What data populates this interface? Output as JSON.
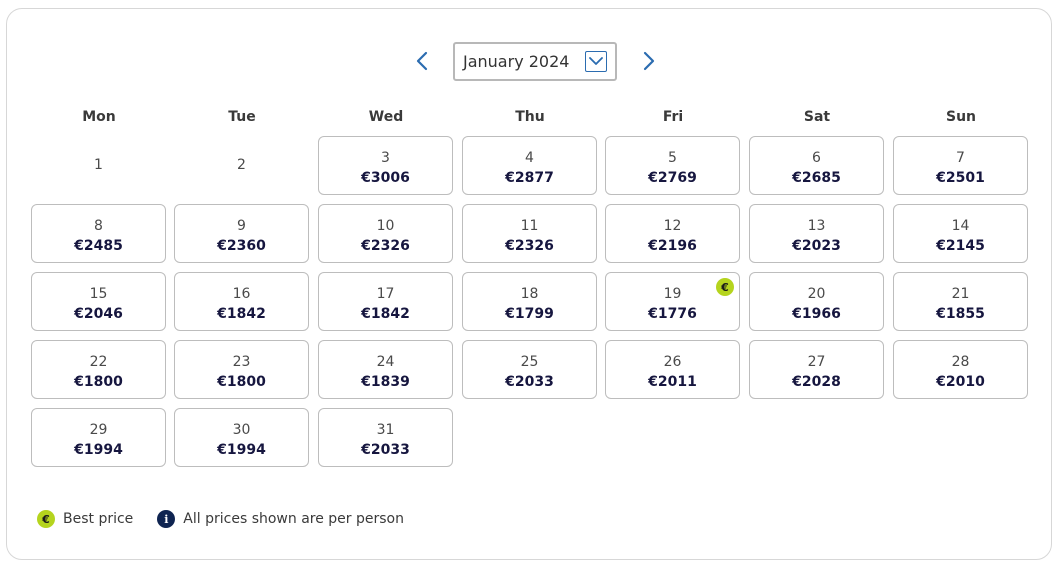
{
  "calendar": {
    "month_label": "January 2024",
    "weekdays": [
      "Mon",
      "Tue",
      "Wed",
      "Thu",
      "Fri",
      "Sat",
      "Sun"
    ],
    "days": [
      {
        "day": "1",
        "price": ""
      },
      {
        "day": "2",
        "price": ""
      },
      {
        "day": "3",
        "price": "€3006"
      },
      {
        "day": "4",
        "price": "€2877"
      },
      {
        "day": "5",
        "price": "€2769"
      },
      {
        "day": "6",
        "price": "€2685"
      },
      {
        "day": "7",
        "price": "€2501"
      },
      {
        "day": "8",
        "price": "€2485"
      },
      {
        "day": "9",
        "price": "€2360"
      },
      {
        "day": "10",
        "price": "€2326"
      },
      {
        "day": "11",
        "price": "€2326"
      },
      {
        "day": "12",
        "price": "€2196"
      },
      {
        "day": "13",
        "price": "€2023"
      },
      {
        "day": "14",
        "price": "€2145"
      },
      {
        "day": "15",
        "price": "€2046"
      },
      {
        "day": "16",
        "price": "€1842"
      },
      {
        "day": "17",
        "price": "€1842"
      },
      {
        "day": "18",
        "price": "€1799"
      },
      {
        "day": "19",
        "price": "€1776",
        "best": true
      },
      {
        "day": "20",
        "price": "€1966"
      },
      {
        "day": "21",
        "price": "€1855"
      },
      {
        "day": "22",
        "price": "€1800"
      },
      {
        "day": "23",
        "price": "€1800"
      },
      {
        "day": "24",
        "price": "€1839"
      },
      {
        "day": "25",
        "price": "€2033"
      },
      {
        "day": "26",
        "price": "€2011"
      },
      {
        "day": "27",
        "price": "€2028"
      },
      {
        "day": "28",
        "price": "€2010"
      },
      {
        "day": "29",
        "price": "€1994"
      },
      {
        "day": "30",
        "price": "€1994"
      },
      {
        "day": "31",
        "price": "€2033"
      }
    ],
    "best_badge_symbol": "€"
  },
  "legend": {
    "best_price_icon": "€",
    "best_price_label": "Best price",
    "info_icon": "i",
    "info_label": "All prices shown are per person"
  },
  "colors": {
    "accent_blue": "#2b6cb0",
    "best_price_green": "#b5d41e",
    "price_text": "#16163f",
    "info_icon_bg": "#0f2451"
  },
  "icons": {
    "prev": "chevron-left-icon",
    "next": "chevron-right-icon",
    "dropdown": "chevron-down-icon",
    "best": "euro-badge-icon",
    "info": "info-icon"
  }
}
